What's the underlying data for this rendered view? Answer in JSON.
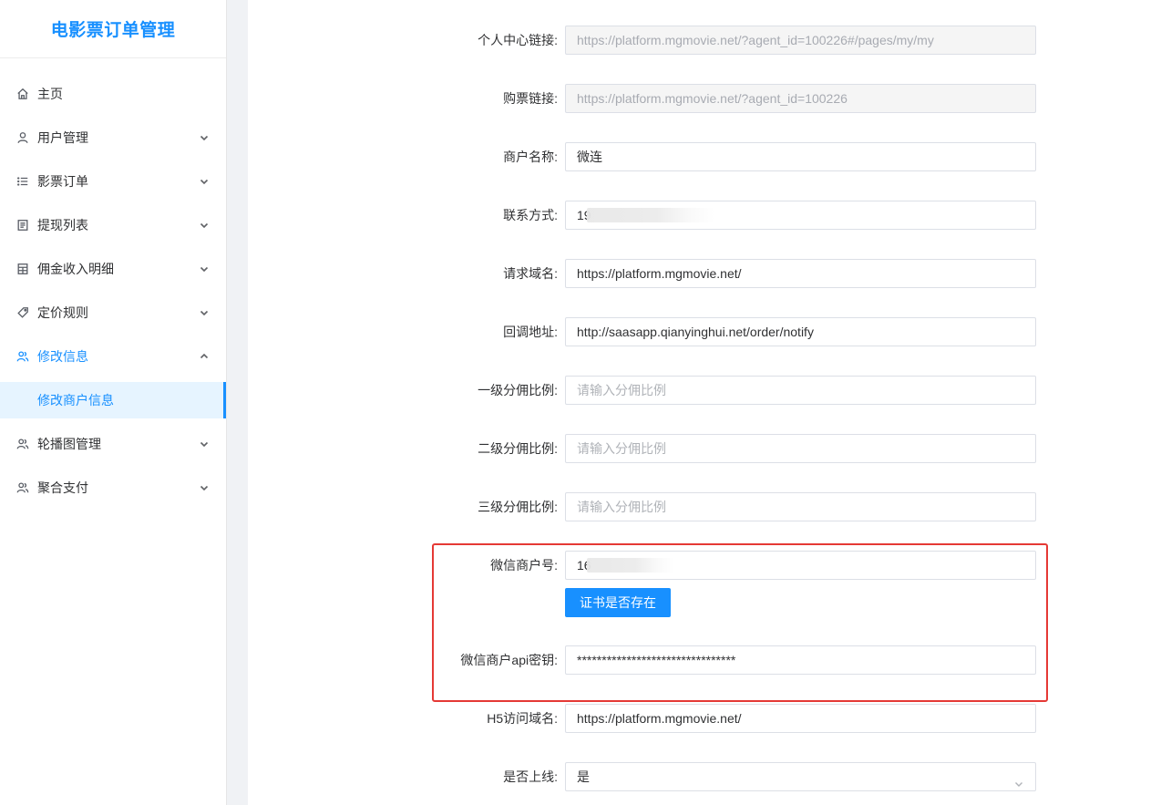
{
  "app": {
    "title": "电影票订单管理"
  },
  "sidebar": {
    "items": [
      {
        "label": "主页",
        "icon": "home-icon"
      },
      {
        "label": "用户管理",
        "icon": "user-icon"
      },
      {
        "label": "影票订单",
        "icon": "list-icon"
      },
      {
        "label": "提现列表",
        "icon": "document-icon"
      },
      {
        "label": "佣金收入明细",
        "icon": "calculator-icon"
      },
      {
        "label": "定价规则",
        "icon": "tag-icon"
      },
      {
        "label": "修改信息",
        "icon": "users-icon"
      },
      {
        "label": "轮播图管理",
        "icon": "users-icon"
      },
      {
        "label": "聚合支付",
        "icon": "users-icon"
      }
    ],
    "active_sub": {
      "label": "修改商户信息"
    }
  },
  "form": {
    "personal_link": {
      "label": "个人中心链接:",
      "value": "https://platform.mgmovie.net/?agent_id=100226#/pages/my/my"
    },
    "ticket_link": {
      "label": "购票链接:",
      "value": "https://platform.mgmovie.net/?agent_id=100226"
    },
    "merchant_name": {
      "label": "商户名称:",
      "value": "微连"
    },
    "contact": {
      "label": "联系方式:",
      "value": "19"
    },
    "request_domain": {
      "label": "请求域名:",
      "value": "https://platform.mgmovie.net/"
    },
    "callback_url": {
      "label": "回调地址:",
      "value": "http://saasapp.qianyinghui.net/order/notify"
    },
    "level1_ratio": {
      "label": "一级分佣比例:",
      "placeholder": "请输入分佣比例"
    },
    "level2_ratio": {
      "label": "二级分佣比例:",
      "placeholder": "请输入分佣比例"
    },
    "level3_ratio": {
      "label": "三级分佣比例:",
      "placeholder": "请输入分佣比例"
    },
    "wechat_merchant_id": {
      "label": "微信商户号:",
      "value": "16"
    },
    "cert_button": {
      "label": "证书是否存在"
    },
    "wechat_api_key": {
      "label": "微信商户api密钥:",
      "value": "********************************"
    },
    "h5_domain": {
      "label": "H5访问域名:",
      "value": "https://platform.mgmovie.net/"
    },
    "online": {
      "label": "是否上线:",
      "value": "是"
    }
  },
  "colors": {
    "accent": "#1890ff",
    "highlight": "#e53935"
  }
}
